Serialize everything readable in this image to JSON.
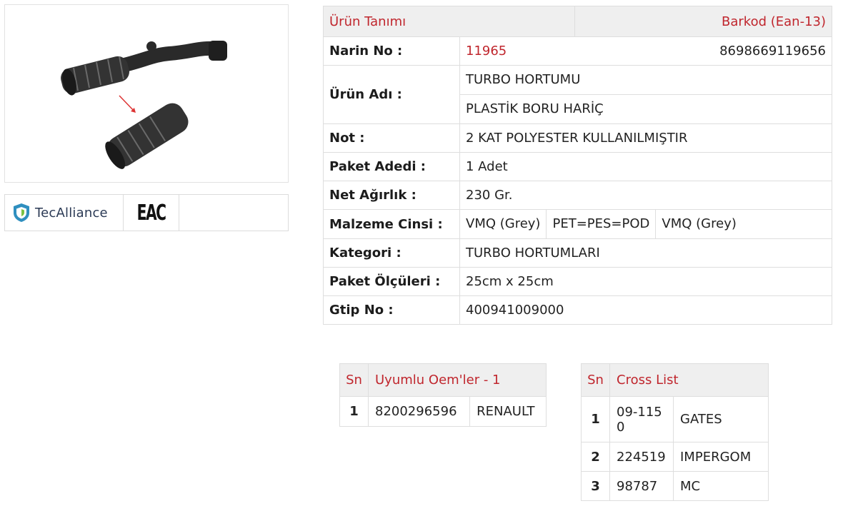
{
  "product_image": {
    "icon": "turbo-hose-photo"
  },
  "logos": {
    "tecalliance": "TecAlliance",
    "eac": "EAC"
  },
  "info": {
    "header_left": "Ürün Tanımı",
    "header_right": "Barkod (Ean-13)",
    "rows": {
      "narin_label": "Narin No :",
      "narin_value": "11965",
      "barcode": "8698669119656",
      "urun_label": "Ürün Adı :",
      "urun_line1": "TURBO HORTUMU",
      "urun_line2": "PLASTİK BORU HARİÇ",
      "not_label": "Not :",
      "not_value": "2 KAT POLYESTER KULLANILMIŞTIR",
      "paket_label": "Paket Adedi :",
      "paket_value": "1 Adet",
      "agirlik_label": "Net Ağırlık :",
      "agirlik_value": "230 Gr.",
      "malzeme_label": "Malzeme Cinsi :",
      "malzeme_values": [
        "VMQ (Grey)",
        "PET=PES=POD",
        "VMQ (Grey)"
      ],
      "kategori_label": "Kategori :",
      "kategori_value": "TURBO HORTUMLARI",
      "olcu_label": "Paket Ölçüleri :",
      "olcu_value": "25cm x 25cm",
      "gtip_label": "Gtip No :",
      "gtip_value": "400941009000"
    }
  },
  "oem": {
    "sn_header": "Sn",
    "title": "Uyumlu Oem'ler - 1",
    "rows": [
      {
        "sn": "1",
        "code": "8200296596",
        "brand": "RENAULT"
      }
    ]
  },
  "cross": {
    "sn_header": "Sn",
    "title": "Cross List",
    "rows": [
      {
        "sn": "1",
        "code": "09-1150",
        "brand": "GATES"
      },
      {
        "sn": "2",
        "code": "224519",
        "brand": "IMPERGOM"
      },
      {
        "sn": "3",
        "code": "98787",
        "brand": "MC"
      }
    ]
  },
  "colors": {
    "accent": "#c0262d",
    "header_bg": "#efefef",
    "border": "#dedede"
  }
}
